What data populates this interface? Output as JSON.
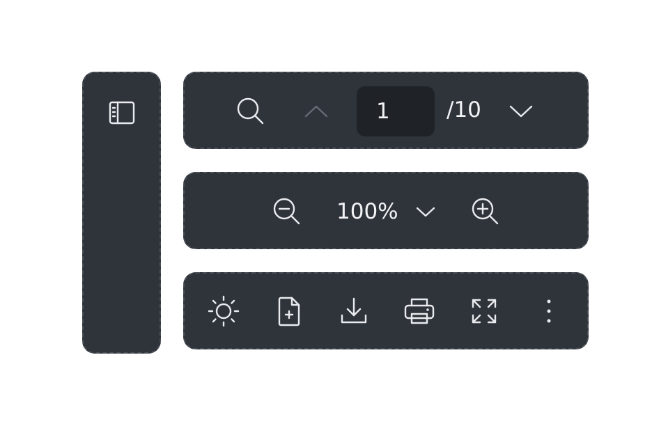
{
  "sidebar": {
    "toggle_icon": "sidebar-toggle-icon"
  },
  "navigation": {
    "search_icon": "search-icon",
    "prev_icon": "chevron-up-icon",
    "prev_disabled": true,
    "current_page": "1",
    "page_total": "/10",
    "next_icon": "chevron-down-icon"
  },
  "zoom": {
    "zoom_out_icon": "zoom-out-icon",
    "level": "100%",
    "dropdown_icon": "chevron-down-icon",
    "zoom_in_icon": "zoom-in-icon"
  },
  "tools": {
    "items": [
      {
        "icon": "brightness-icon"
      },
      {
        "icon": "add-document-icon"
      },
      {
        "icon": "download-icon"
      },
      {
        "icon": "print-icon"
      },
      {
        "icon": "fullscreen-icon"
      },
      {
        "icon": "more-vertical-icon"
      }
    ]
  },
  "colors": {
    "panel_bg": "#2f343b",
    "panel_border": "#4a4f58",
    "input_bg": "#1f2226",
    "icon": "#e9ebee",
    "icon_disabled": "#656b74",
    "page_bg": "#ffffff"
  }
}
